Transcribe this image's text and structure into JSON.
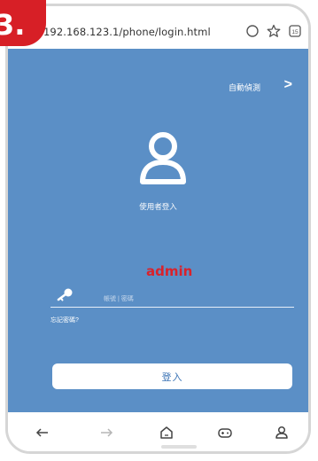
{
  "step_badge": "3.",
  "browser": {
    "url": "192.168.123.1/phone/login.html",
    "tab_count": "15",
    "icons": [
      "circle-icon",
      "star-icon",
      "tabs-icon"
    ]
  },
  "app": {
    "auto_detect_label": "自動偵測",
    "chevron_icon": "chevron-right-icon",
    "login_title": "使用者登入",
    "overlay_username": "admin",
    "password_placeholder": "帳號 | 密碼",
    "forgot_password": "忘記密碼?",
    "login_button": "登入",
    "colors": {
      "background": "#5b8fc6",
      "accent_red": "#d9222b",
      "button_text": "#3b73b5"
    }
  },
  "nav": {
    "icons": [
      "back-arrow-icon",
      "forward-arrow-icon",
      "home-icon",
      "gamepad-icon",
      "profile-icon"
    ]
  }
}
